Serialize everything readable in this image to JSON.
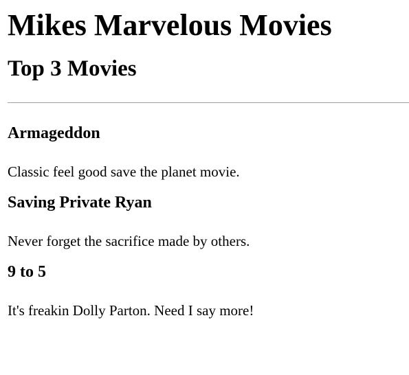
{
  "header": {
    "site_title": "Mikes Marvelous Movies",
    "section_title": "Top 3 Movies"
  },
  "movies": [
    {
      "title": "Armageddon",
      "description": "Classic feel good save the planet movie."
    },
    {
      "title": "Saving Private Ryan",
      "description": "Never forget the sacrifice made by others."
    },
    {
      "title": "9 to 5",
      "description": "It's freakin Dolly Parton. Need I say more!"
    }
  ]
}
